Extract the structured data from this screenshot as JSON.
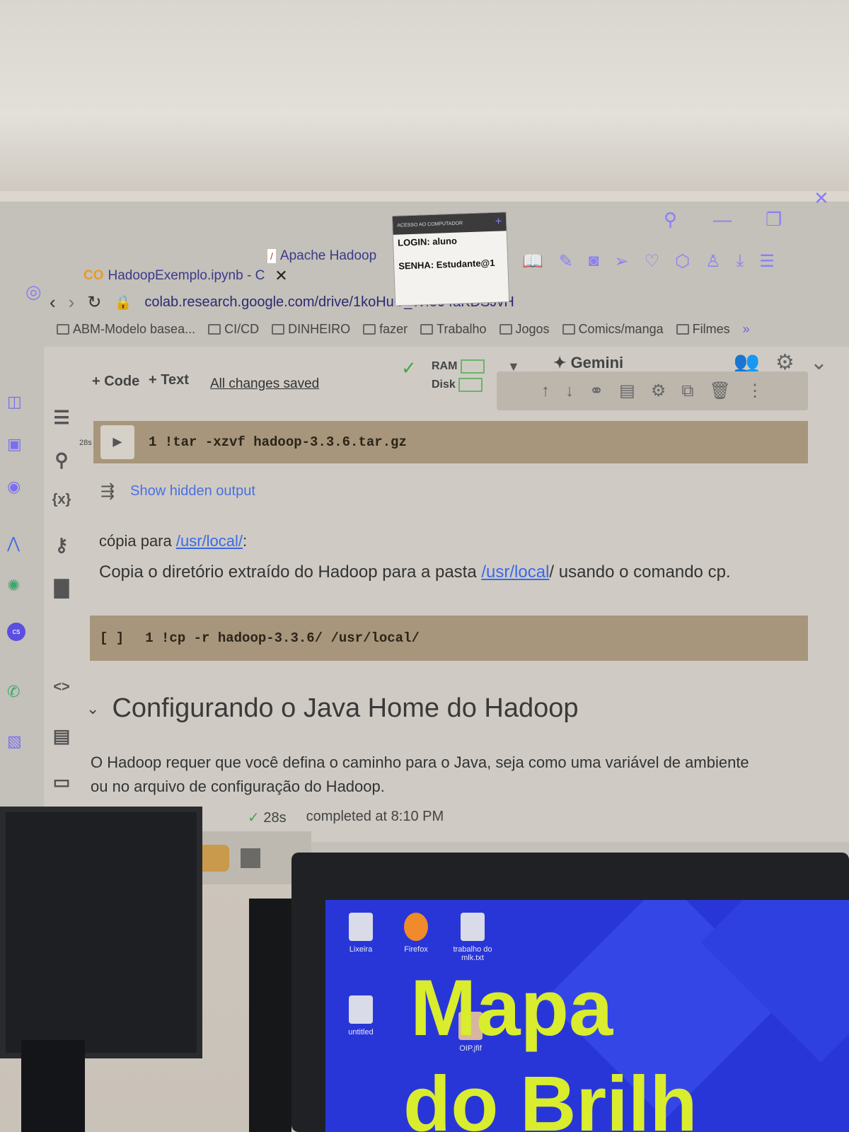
{
  "browser": {
    "tabs": [
      {
        "label": "HadoopExemplo.ipynb - C",
        "icon": "colab-icon"
      },
      {
        "label": "Apache Hadoop",
        "icon": "feather-icon"
      }
    ],
    "url": "colab.research.google.com/drive/1koHuC_Wf804aKDSJvH",
    "bookmarks": [
      "ABM-Modelo basea...",
      "CI/CD",
      "DINHEIRO",
      "fazer",
      "Trabalho",
      "Jogos",
      "Comics/manga",
      "Filmes"
    ],
    "more_bookmarks": "»"
  },
  "sticky_note": {
    "header": "ACESSO AO COMPUTADOR",
    "login": "LOGIN: aluno",
    "senha": "SENHA: Estudante@1"
  },
  "colab": {
    "toolbar": {
      "code_label": "+ Code",
      "text_label": "+ Text",
      "saved_label": "All changes saved",
      "ram_label": "RAM",
      "disk_label": "Disk",
      "gemini_label": "Gemini"
    },
    "cells": {
      "cell1_code": "1 !tar -xzvf hadoop-3.3.6.tar.gz",
      "cell1_time": "28s",
      "hidden_output": "Show hidden output",
      "md1_prefix": "cópia para ",
      "md1_link": "/usr/local/",
      "md1_suffix": ":",
      "md2_prefix": "Copia o diretório extraído do Hadoop para a pasta ",
      "md2_link": "/usr/local",
      "md2_suffix": "/ usando o comando cp.",
      "cell2_bracket": "[ ]",
      "cell2_code": "1 !cp -r hadoop-3.3.6/ /usr/local/",
      "heading": "Configurando o Java Home do Hadoop",
      "md3_line1": "O Hadoop requer que você defina o caminho para o Java, seja como uma variável de ambiente",
      "md3_line2": "ou no arquivo de configuração do Hadoop."
    },
    "status": {
      "time": "28s",
      "completed": "completed at 8:10 PM"
    }
  },
  "desktop": {
    "icons": [
      "Lixeira",
      "Firefox",
      "trabalho do mlk.txt",
      "untitled",
      "OIP.jfif"
    ],
    "wallpaper_text_1": "Mapa",
    "wallpaper_text_2": "do Brilh"
  },
  "colors": {
    "accent": "#6a5ff0",
    "link": "#3a68e8",
    "code_bg": "#a7967c",
    "desktop_bg": "#2836d8",
    "wallpaper_text": "#d9ec2e"
  }
}
